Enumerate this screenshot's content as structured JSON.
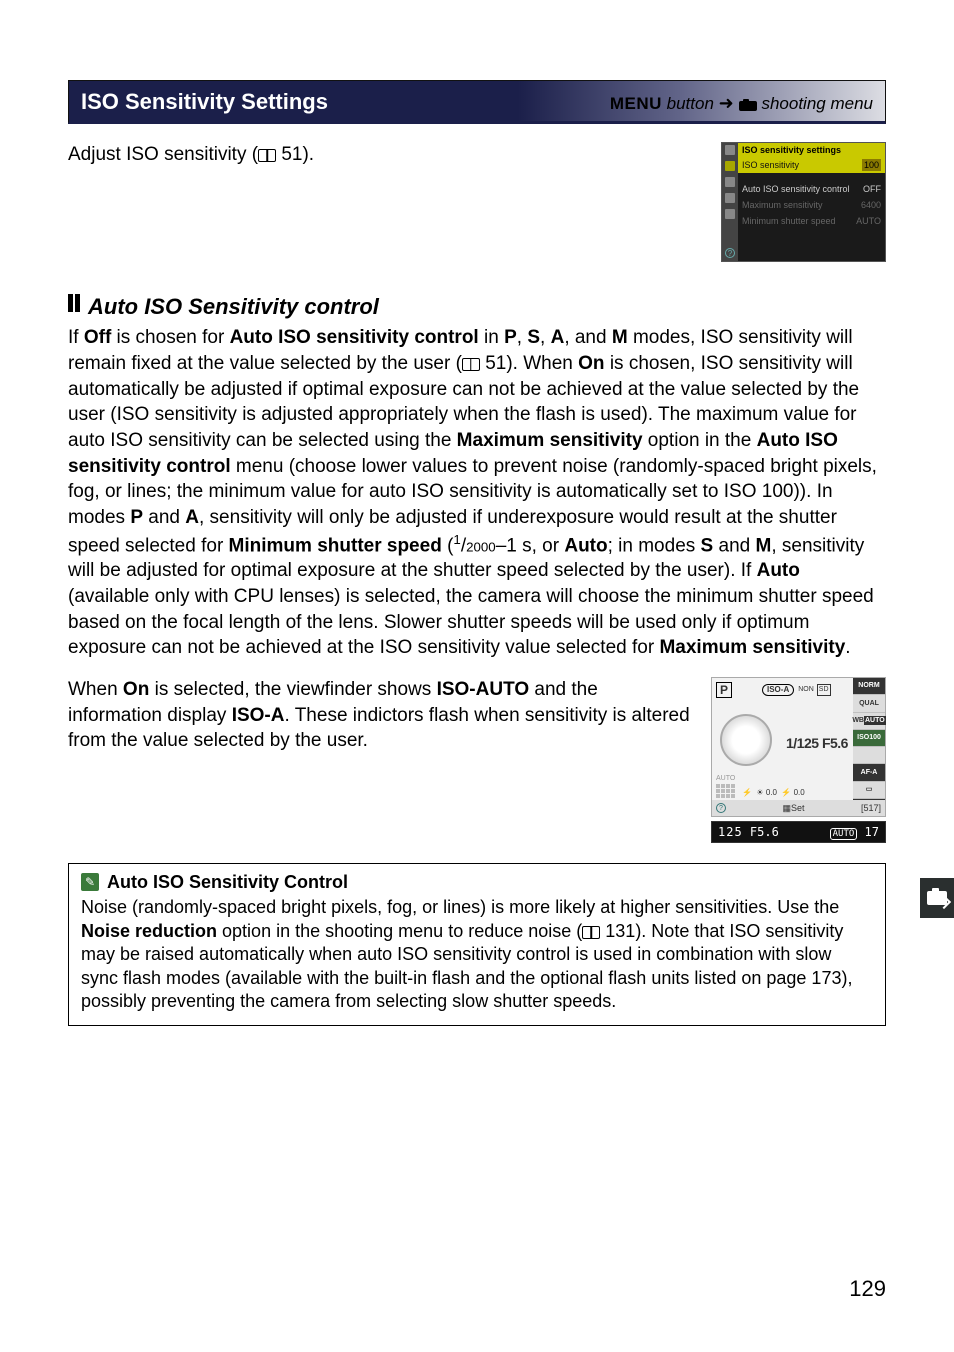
{
  "header": {
    "title": "ISO Sensitivity Settings",
    "menu_label": "MENU",
    "button_word": "button",
    "menu_suffix": "shooting menu"
  },
  "intro": {
    "text_before": "Adjust ISO sensitivity (",
    "page_ref": " 51).",
    "text_after": ""
  },
  "screenshot_menu": {
    "title": "ISO sensitivity settings",
    "row1_label": "ISO sensitivity",
    "row1_value": "100",
    "row2_label": "Auto ISO sensitivity control",
    "row2_value": "OFF",
    "row3_label": "Maximum sensitivity",
    "row3_value": "6400",
    "row4_label": "Minimum shutter speed",
    "row4_value": "AUTO"
  },
  "subhead": "Auto ISO Sensitivity control",
  "para1": {
    "p1": "If ",
    "off": "Off",
    "p2": " is chosen for ",
    "auto_ctrl": "Auto ISO sensitivity control",
    "p3": " in ",
    "mP": "P",
    "mS": "S",
    "mA": "A",
    "mM": "M",
    "p4": ", and ",
    "p5": " modes, ISO sensitivity will remain fixed at the value selected by the user (",
    "ref51": " 51).   When ",
    "on": "On",
    "p6": " is chosen, ISO sensitivity will automatically be adjusted if optimal exposure can not be achieved at the value selected by the user (ISO sensitivity is adjusted appropriately when the flash is used).   The maximum value for auto ISO sensitivity can be selected using the ",
    "maxsens": "Maximum sensitivity",
    "p7": " option in the ",
    "auto_menu": "Auto ISO sensitivity control",
    "p8": " menu (choose lower values to prevent noise (randomly-spaced bright pixels, fog, or lines; the minimum value for auto ISO sensitivity is automatically set to ISO 100)).   In modes ",
    "p9": " and ",
    "p10": ", sensitivity will only be adjusted if underexposure would result at the shutter speed selected for ",
    "minshut": "Minimum shutter speed",
    "p11": " (",
    "frac_num": "1",
    "frac_den": "2000",
    "p12": "–1 s, or ",
    "auto": "Auto",
    "p13": "; in modes ",
    "p14": " and ",
    "p15": ", sensitivity will be adjusted for optimal exposure at the shutter speed selected by the user).  If ",
    "auto2": "Auto",
    "p16": " (available only with CPU lenses) is selected, the camera will choose the minimum shutter speed based on the focal length of the lens.  Slower shutter speeds will be used only if optimum exposure can not be achieved at the ISO sensitivity value selected for ",
    "maxsens2": "Maximum sensitivity",
    "p17": "."
  },
  "para2": {
    "p1": "When ",
    "on": "On",
    "p2": " is selected, the viewfinder shows ",
    "isoauto": "ISO-AUTO",
    "p3": " and the information display ",
    "isoa": "ISO-A",
    "p4": ".   These indictors flash when sensitivity is altered from the value selected by the user."
  },
  "lcd": {
    "mode": "P",
    "iso_a": "ISO-A",
    "non": "NON",
    "sd": "SD",
    "shutter": "1/125",
    "fstop": "F5.6",
    "auto": "AUTO",
    "ev": "0.0",
    "flash_ev": "0.0",
    "set": "Set",
    "count": "[517]",
    "r_norm": "NORM",
    "r_qual": "QUAL",
    "r_wb": "WB",
    "r_wbauto": "AUTO",
    "r_iso": "ISO",
    "r_iso_v": "100",
    "r_afa": "AF-A",
    "strip_left": "125",
    "strip_f": "F5.6",
    "strip_count": "17",
    "strip_auto": "AUTO"
  },
  "note": {
    "title": "Auto ISO Sensitivity Control",
    "p1": "Noise (randomly-spaced bright pixels, fog, or lines) is more likely at higher sensitivities.   Use the ",
    "nr": "Noise reduction",
    "p2": " option in the shooting menu to reduce noise (",
    "ref": " 131).   Note that ISO sensitivity may be raised automatically when auto ISO sensitivity control is used in combination with slow sync flash modes (available with the built-in flash and the optional flash units listed on page 173), possibly preventing the camera from selecting slow shutter speeds."
  },
  "page_number": "129"
}
